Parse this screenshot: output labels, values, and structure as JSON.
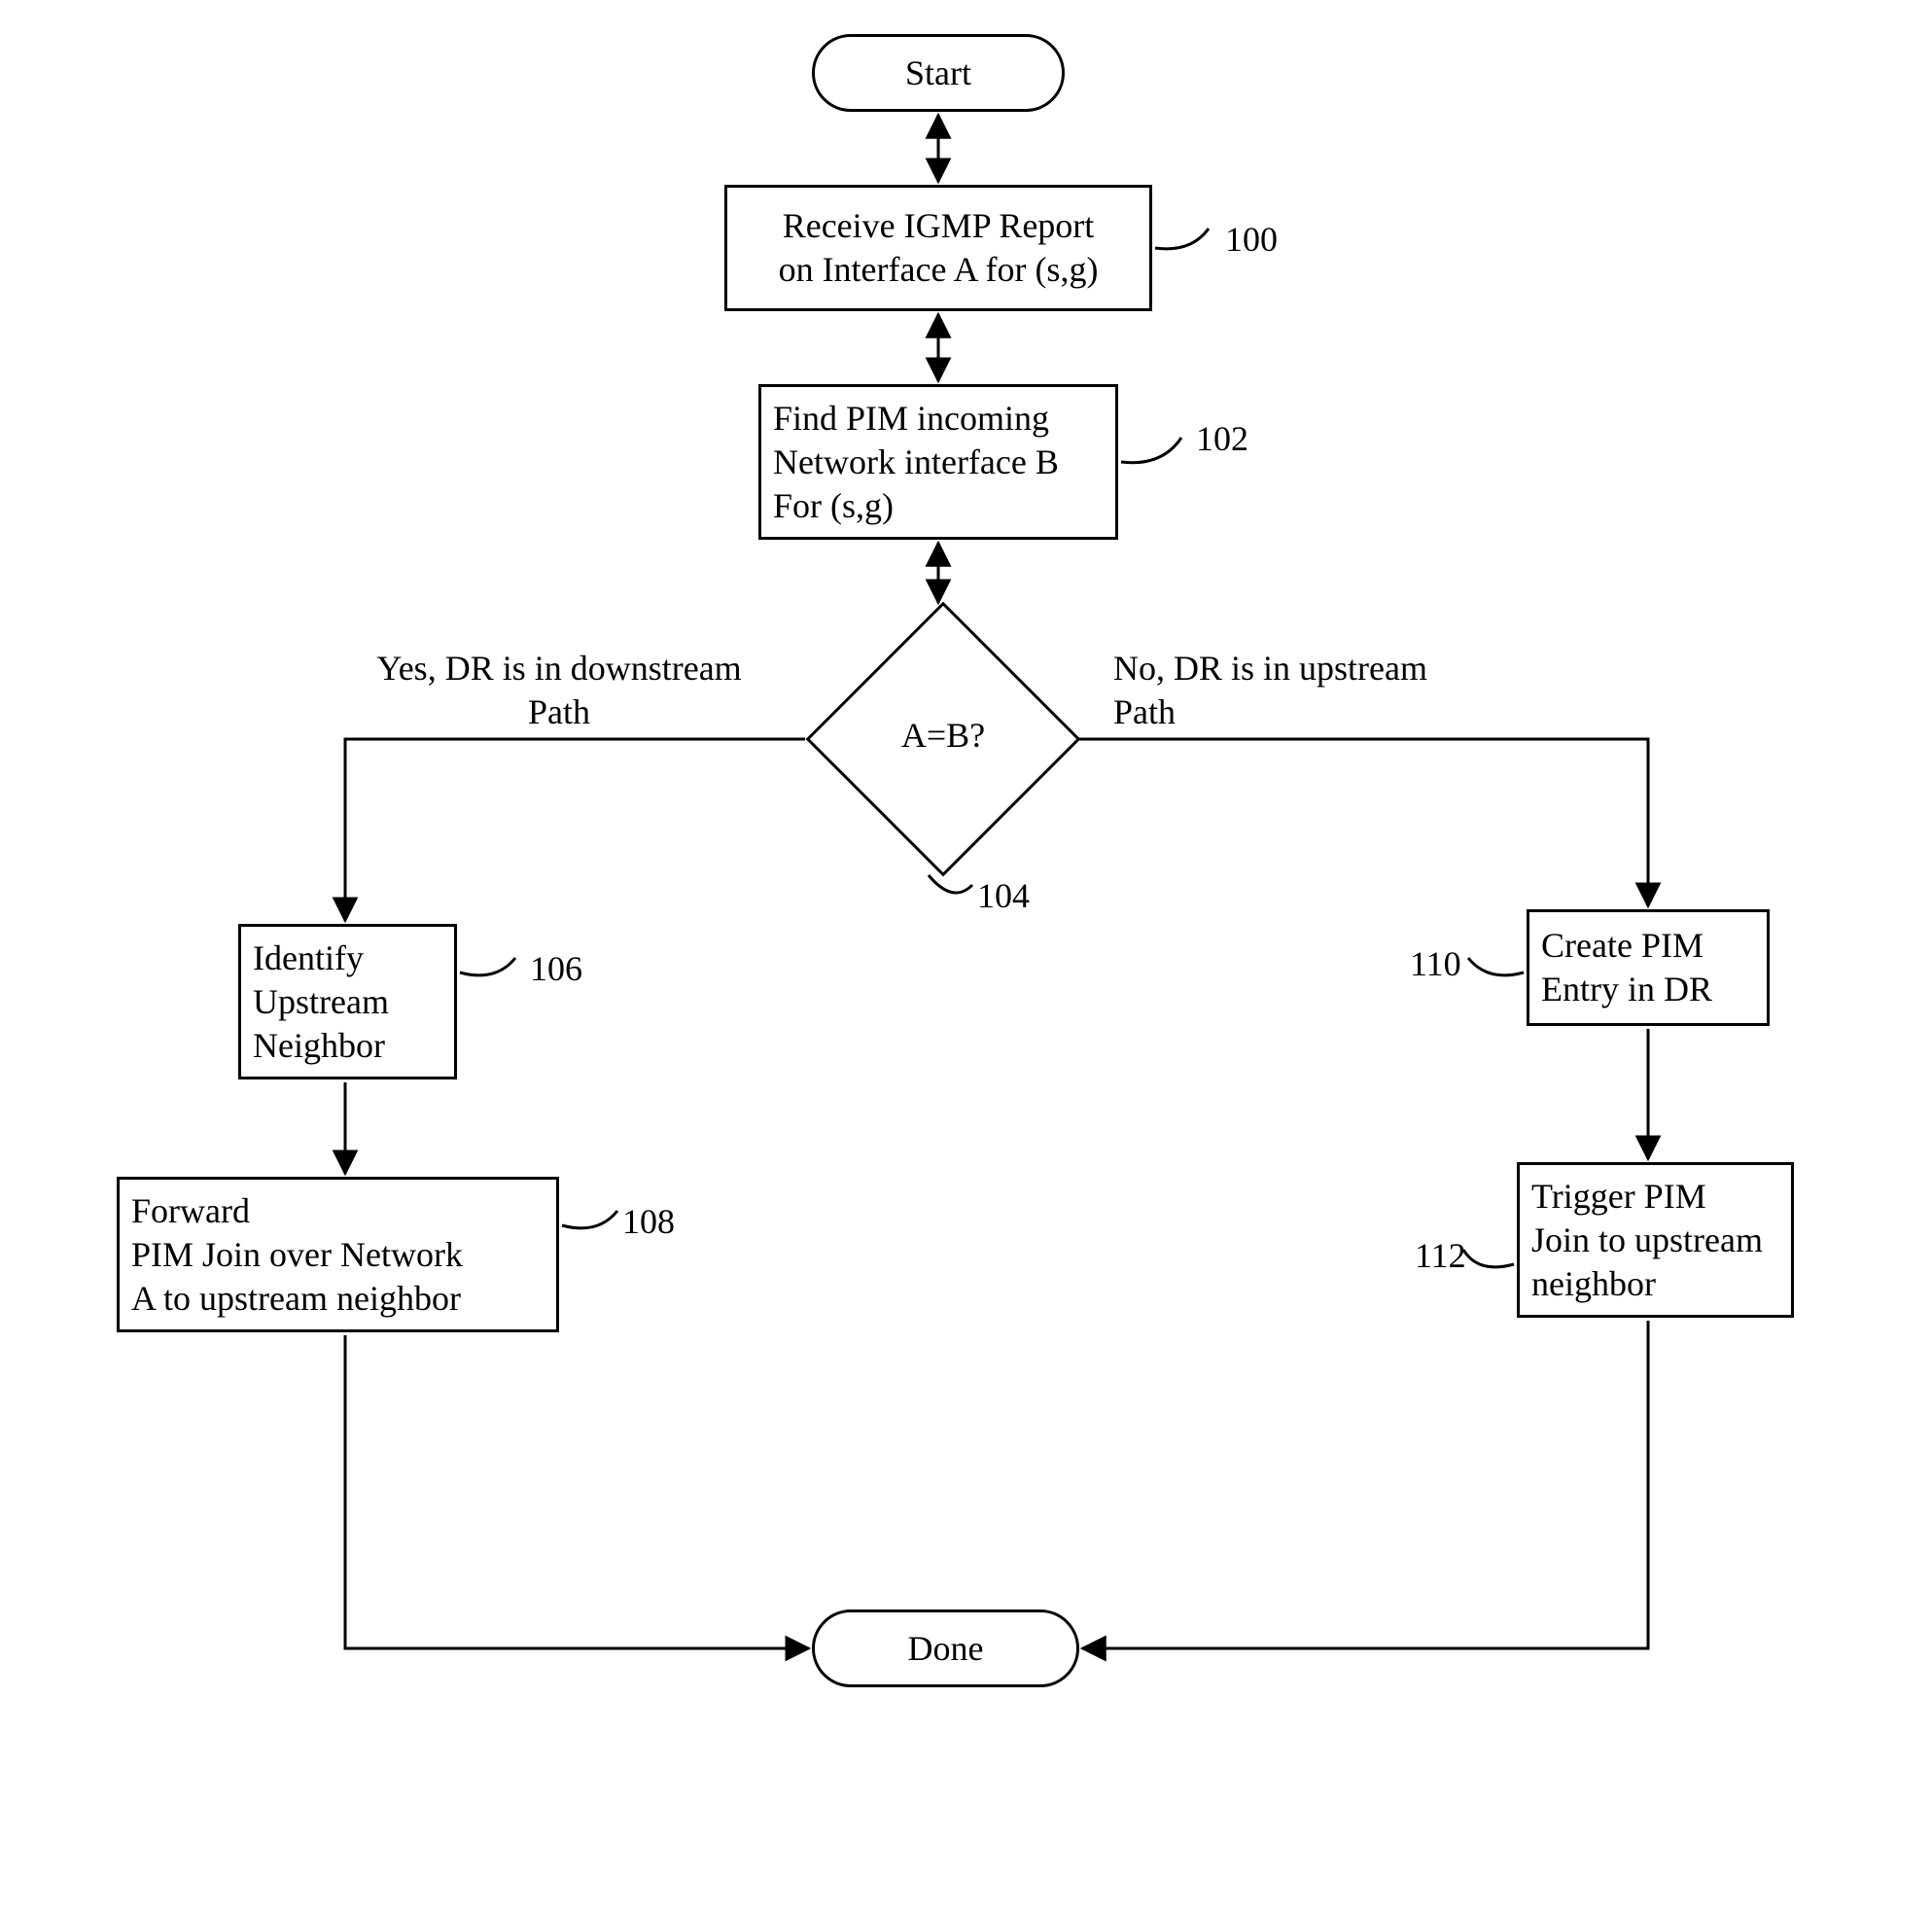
{
  "start": {
    "label": "Start"
  },
  "step100": {
    "text": "Receive IGMP Report\non Interface A for (s,g)",
    "ref": "100"
  },
  "step102": {
    "text": "Find PIM incoming\nNetwork interface B\nFor (s,g)",
    "ref": "102"
  },
  "decision104": {
    "text": "A=B?",
    "ref": "104",
    "yes_label": "Yes, DR is in downstream\nPath",
    "no_label": "No, DR is in upstream\nPath"
  },
  "step106": {
    "text": "Identify\nUpstream\nNeighbor",
    "ref": "106"
  },
  "step108": {
    "text": "Forward\nPIM Join over Network\nA to upstream neighbor",
    "ref": "108"
  },
  "step110": {
    "text": "Create PIM\nEntry in DR",
    "ref": "110"
  },
  "step112": {
    "text": "Trigger PIM\nJoin to upstream\nneighbor",
    "ref": "112"
  },
  "done": {
    "label": "Done"
  }
}
